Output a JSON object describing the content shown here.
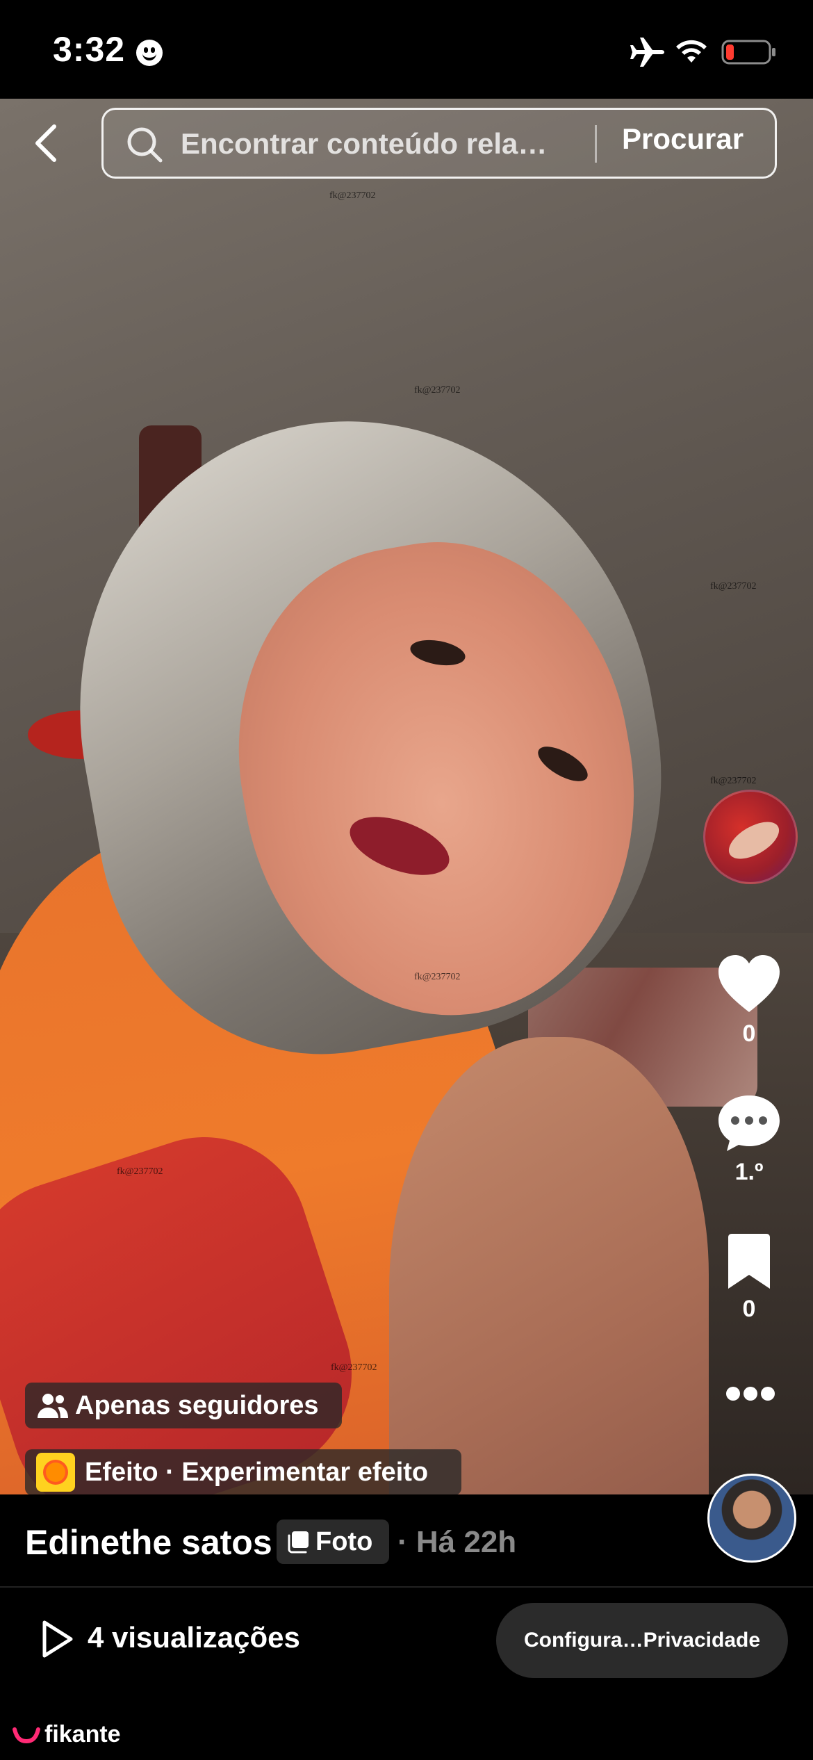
{
  "status_bar": {
    "time": "3:32"
  },
  "search": {
    "placeholder": "Encontrar conteúdo rela…",
    "button_label": "Procurar"
  },
  "watermark": "fk@237702",
  "actions": {
    "likes": "0",
    "comments": "1.º",
    "saves": "0"
  },
  "overlay": {
    "followers_label": "Apenas seguidores",
    "effect_label": "Efeito · Experimentar efeito"
  },
  "post": {
    "author": "Edinethe satos",
    "type_label": "Foto",
    "time_ago": "· Há 22h"
  },
  "views": {
    "label": "4 visualizações"
  },
  "privacy_button": "Configura…Privacidade",
  "brand": {
    "name": "fikante",
    "color": "#ff2a75"
  },
  "icons": [
    "smile-icon",
    "airplane-icon",
    "wifi-icon",
    "battery-icon",
    "back-arrow-icon",
    "search-icon",
    "heart-icon",
    "comment-icon",
    "bookmark-icon",
    "more-icon",
    "followers-icon",
    "effect-icon",
    "photo-icon",
    "play-icon"
  ]
}
